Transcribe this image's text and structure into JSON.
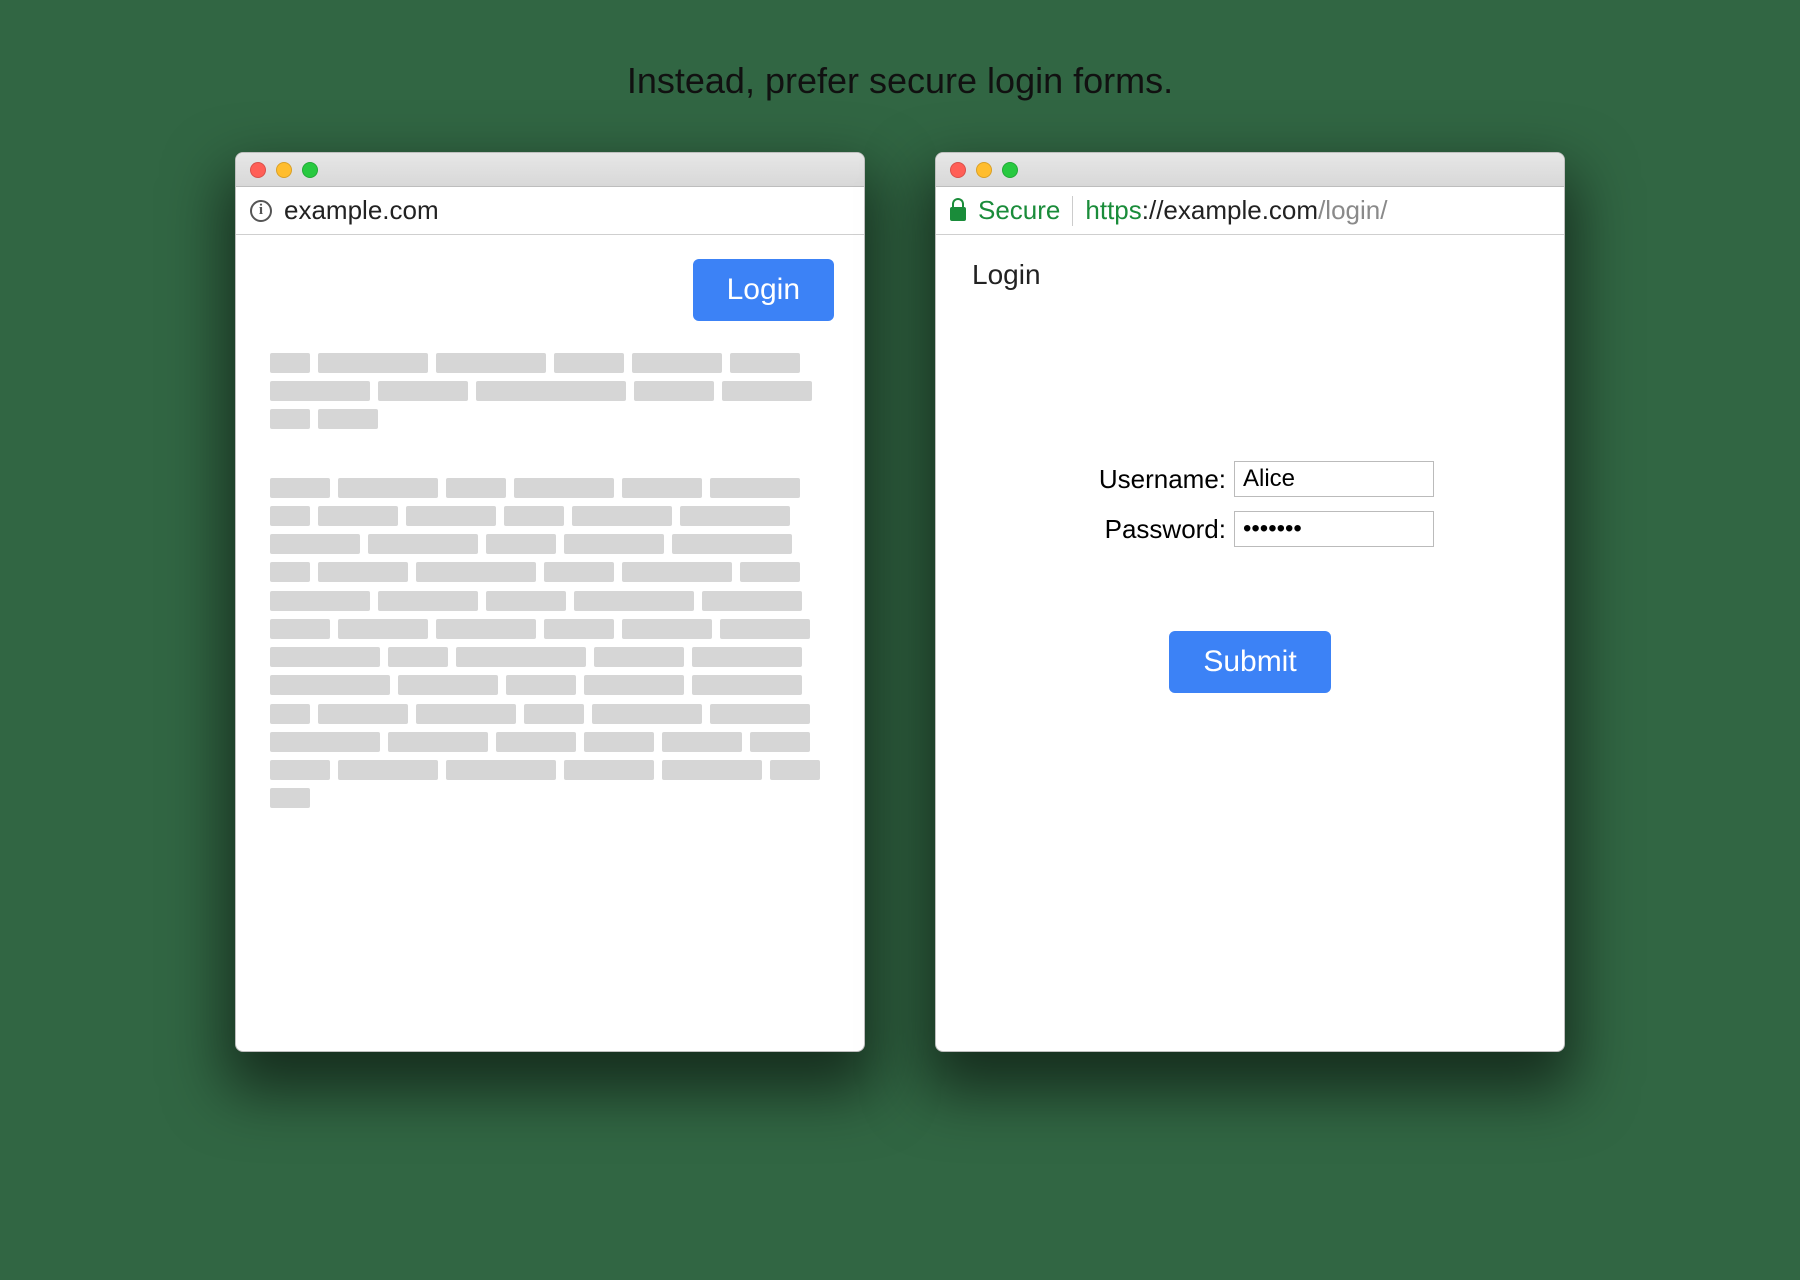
{
  "caption": "Instead, prefer secure login forms.",
  "left": {
    "address": "example.com",
    "login_button": "Login"
  },
  "right": {
    "secure_label": "Secure",
    "address_scheme": "https",
    "address_host": "://example.com",
    "address_path": "/login/",
    "page_title": "Login",
    "username_label": "Username:",
    "username_value": "Alice",
    "password_label": "Password:",
    "password_value": "•••••••",
    "submit_label": "Submit"
  }
}
